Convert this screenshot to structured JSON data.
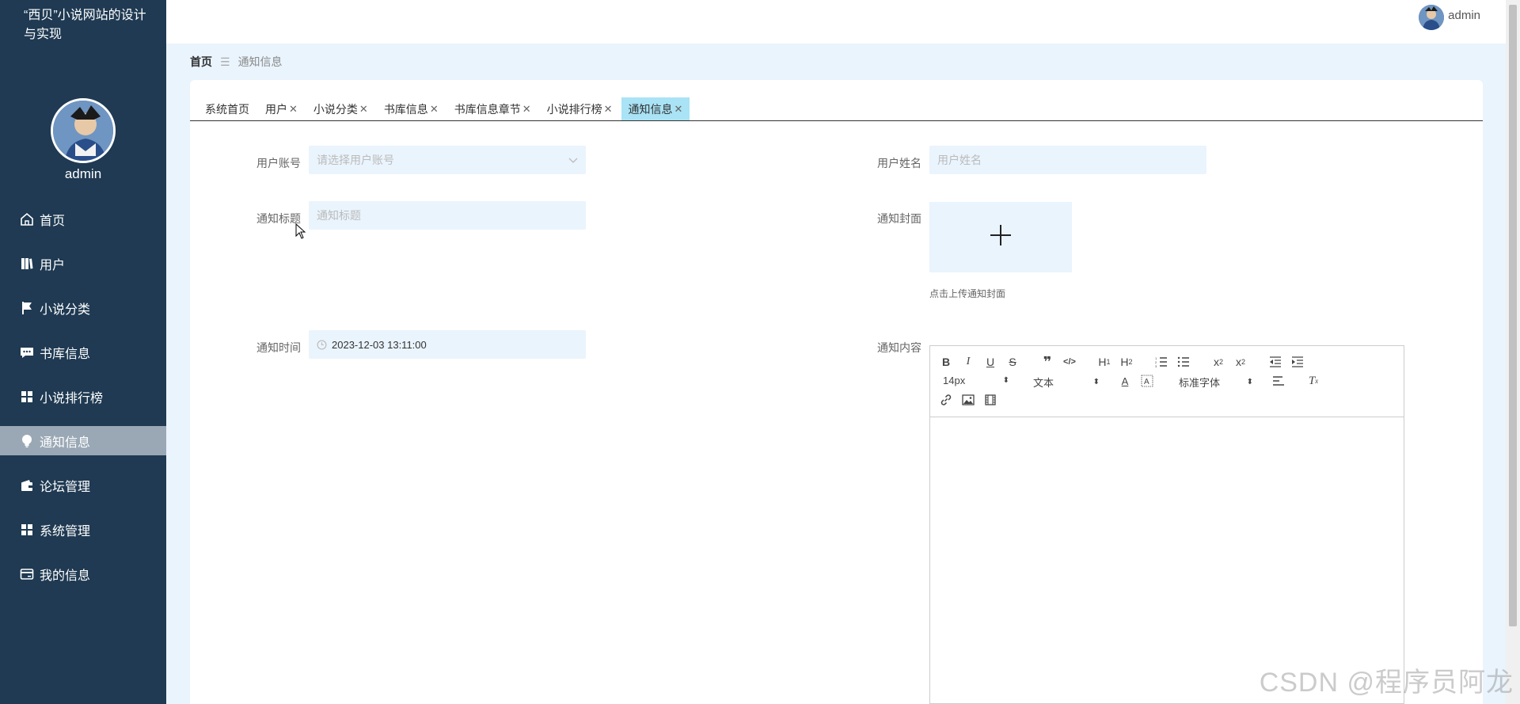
{
  "app": {
    "title": "“西贝”小说网站的设计与实现"
  },
  "user": {
    "name": "admin"
  },
  "sidebar": {
    "items": [
      {
        "label": "首页",
        "icon": "home-icon"
      },
      {
        "label": "用户",
        "icon": "book-icon"
      },
      {
        "label": "小说分类",
        "icon": "flag-icon"
      },
      {
        "label": "书库信息",
        "icon": "chat-icon"
      },
      {
        "label": "小说排行榜",
        "icon": "grid-icon"
      },
      {
        "label": "通知信息",
        "icon": "bulb-icon",
        "active": true
      },
      {
        "label": "论坛管理",
        "icon": "wallet-icon"
      },
      {
        "label": "系统管理",
        "icon": "grid-icon"
      },
      {
        "label": "我的信息",
        "icon": "card-icon"
      }
    ]
  },
  "breadcrumb": {
    "home": "首页",
    "current": "通知信息"
  },
  "tabs": [
    {
      "label": "系统首页",
      "closable": false
    },
    {
      "label": "用户",
      "closable": true
    },
    {
      "label": "小说分类",
      "closable": true
    },
    {
      "label": "书库信息",
      "closable": true
    },
    {
      "label": "书库信息章节",
      "closable": true
    },
    {
      "label": "小说排行榜",
      "closable": true
    },
    {
      "label": "通知信息",
      "closable": true,
      "active": true
    }
  ],
  "form": {
    "account_label": "用户账号",
    "account_placeholder": "请选择用户账号",
    "name_label": "用户姓名",
    "name_placeholder": "用户姓名",
    "title_label": "通知标题",
    "title_placeholder": "通知标题",
    "cover_label": "通知封面",
    "cover_hint": "点击上传通知封面",
    "time_label": "通知时间",
    "time_value": "2023-12-03 13:11:00",
    "content_label": "通知内容"
  },
  "editor": {
    "font_size": "14px",
    "header": "文本",
    "font_family": "标准字体"
  },
  "watermark": "CSDN @程序员阿龙"
}
